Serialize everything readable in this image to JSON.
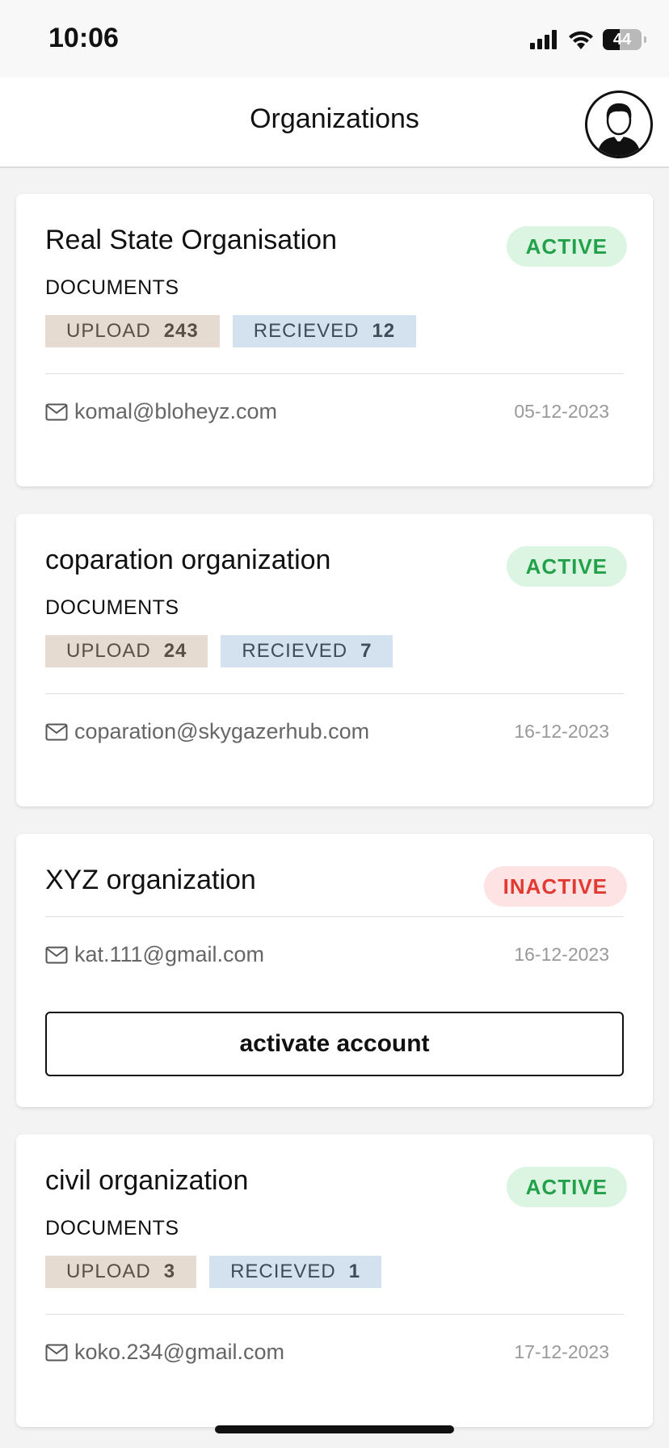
{
  "status_bar": {
    "time": "10:06",
    "battery_level": 44,
    "battery_text": "44"
  },
  "header": {
    "title": "Organizations"
  },
  "labels": {
    "documents": "DOCUMENTS",
    "upload": "UPLOAD",
    "received": "RECIEVED"
  },
  "organizations": [
    {
      "name": "Real State Organisation",
      "status": "ACTIVE",
      "upload_count": "243",
      "received_count": "12",
      "email": "komal@bloheyz.com",
      "date": "05-12-2023"
    },
    {
      "name": "coparation organization",
      "status": "ACTIVE",
      "upload_count": "24",
      "received_count": "7",
      "email": "coparation@skygazerhub.com",
      "date": "16-12-2023"
    },
    {
      "name": "XYZ organization",
      "status": "INACTIVE",
      "email": "kat.111@gmail.com",
      "date": "16-12-2023",
      "action_label": "activate account"
    },
    {
      "name": "civil organization",
      "status": "ACTIVE",
      "upload_count": "3",
      "received_count": "1",
      "email": "koko.234@gmail.com",
      "date": "17-12-2023"
    }
  ],
  "colors": {
    "active_text": "#22a14a",
    "active_bg": "#dcf5e2",
    "inactive_text": "#e03a32",
    "inactive_bg": "#fde3e3",
    "upload_chip_bg": "#e6dbd1",
    "received_chip_bg": "#d3e2ee"
  },
  "icons": [
    "signal-icon",
    "wifi-icon",
    "battery-icon",
    "user-avatar-icon",
    "mail-icon"
  ]
}
